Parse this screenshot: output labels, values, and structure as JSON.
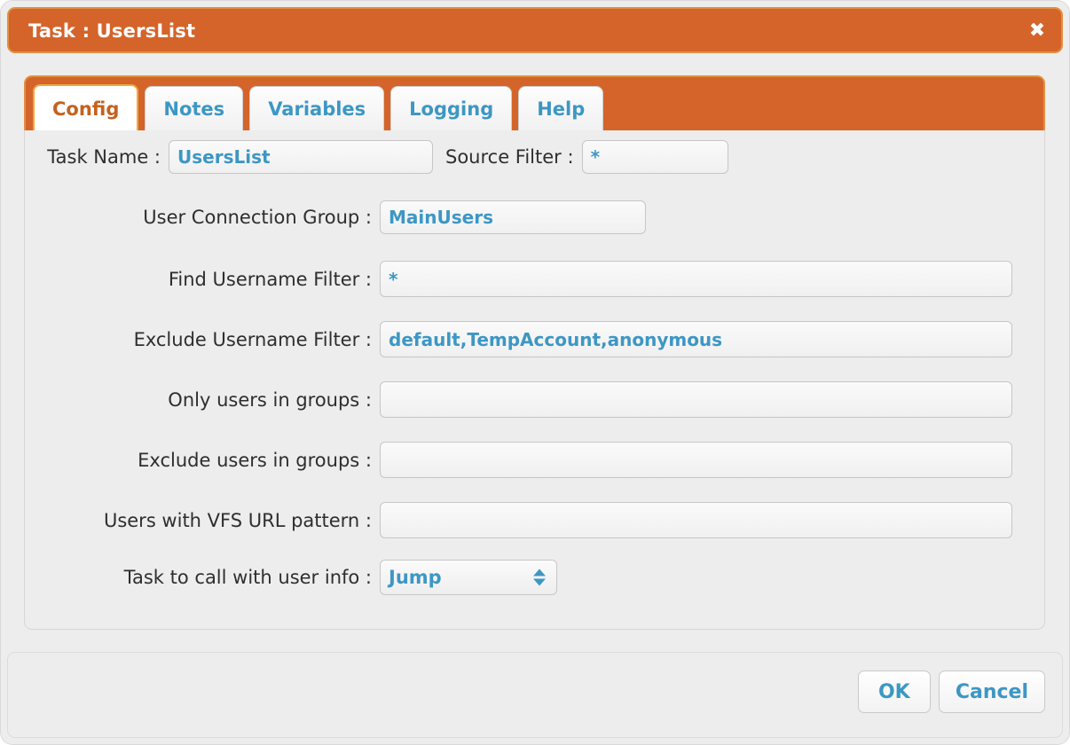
{
  "window": {
    "title": "Task : UsersList",
    "close_icon": "close-icon",
    "close_glyph": "✖"
  },
  "tabs": [
    {
      "label": "Config",
      "active": true
    },
    {
      "label": "Notes",
      "active": false
    },
    {
      "label": "Variables",
      "active": false
    },
    {
      "label": "Logging",
      "active": false
    },
    {
      "label": "Help",
      "active": false
    }
  ],
  "form": {
    "task_name": {
      "label": "Task Name :",
      "value": "UsersList",
      "placeholder": ""
    },
    "source_filter": {
      "label": "Source Filter :",
      "value": "*",
      "placeholder": ""
    },
    "user_connection_group": {
      "label": "User Connection Group :",
      "value": "MainUsers",
      "placeholder": ""
    },
    "find_username_filter": {
      "label": "Find Username Filter :",
      "value": "*",
      "placeholder": ""
    },
    "exclude_username_filter": {
      "label": "Exclude Username Filter :",
      "value": "default,TempAccount,anonymous",
      "placeholder": ""
    },
    "only_users_in_groups": {
      "label": "Only users in groups :",
      "value": "",
      "placeholder": ""
    },
    "exclude_users_in_groups": {
      "label": "Exclude users in groups :",
      "value": "",
      "placeholder": ""
    },
    "users_with_vfs_url_pattern": {
      "label": "Users with VFS URL pattern :",
      "value": "",
      "placeholder": ""
    },
    "task_to_call": {
      "label": "Task to call with user info :",
      "value": "Jump",
      "options": [
        "Jump"
      ]
    }
  },
  "footer": {
    "ok_label": "OK",
    "cancel_label": "Cancel"
  },
  "colors": {
    "titlebar_orange": "#d4642a",
    "titlebar_border": "#e2913f",
    "accent_blue": "#3d97c4",
    "active_tab_text": "#c4621f",
    "active_tab_border": "#f0a83e",
    "panel_background": "#ededed"
  }
}
